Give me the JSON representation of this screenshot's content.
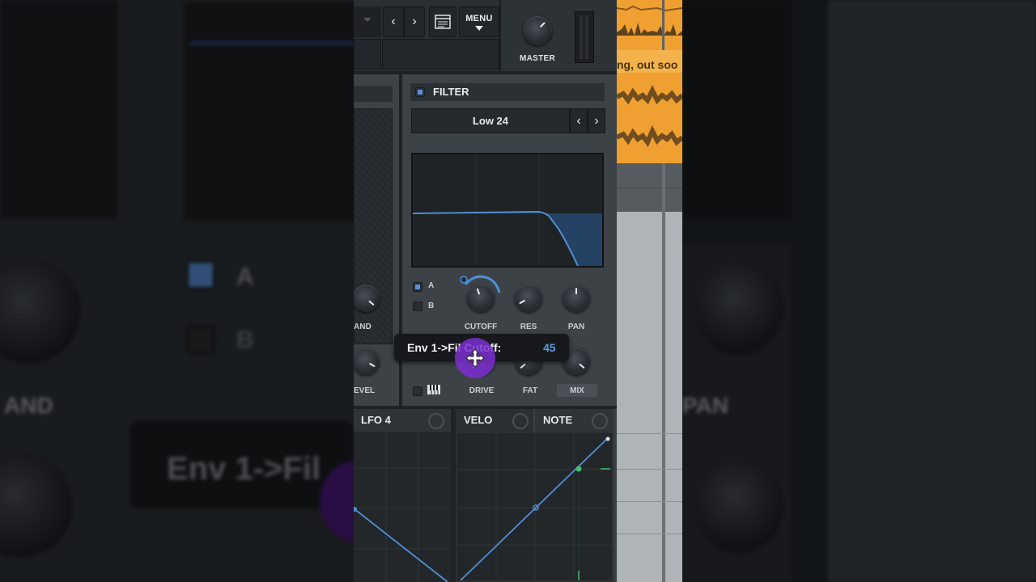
{
  "toolbar": {
    "menu_label": "MENU",
    "master_label": "MASTER"
  },
  "filter": {
    "title": "FILTER",
    "type": "Low 24",
    "routing_a": "A",
    "routing_b": "B",
    "knobs_top": [
      "CUTOFF",
      "RES",
      "PAN"
    ],
    "knobs_bottom": [
      "DRIVE",
      "FAT",
      "MIX"
    ],
    "left_knob_top": "AND",
    "left_knob_bottom": "EVEL"
  },
  "tooltip": {
    "label": "Env 1->Fil Cutoff:",
    "value": "45"
  },
  "mod_tabs": [
    "LFO 4",
    "VELO",
    "NOTE"
  ],
  "track": {
    "clip_text": "ng, out soo"
  },
  "backdrop": {
    "left_a": "A",
    "left_b": "B",
    "left_band": "AND",
    "left_tooltip": "Env 1->Fil",
    "right_pan": "PAN"
  },
  "colors": {
    "accent": "#5b8fd9",
    "purple": "#7b2fd0",
    "clip": "#f0a030",
    "panel": "#3a3f44"
  }
}
